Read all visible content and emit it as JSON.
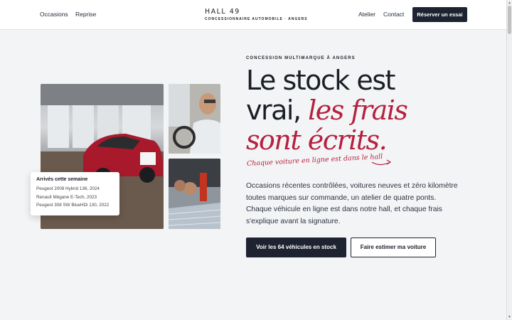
{
  "header": {
    "nav_left": [
      "Occasions",
      "Reprise"
    ],
    "brand_name": "HALL 49",
    "brand_subtitle": "CONCESSIONNAIRE AUTOMOBILE · ANGERS",
    "nav_right": [
      "Atelier",
      "Contact"
    ],
    "cta_label": "Réserver un essai"
  },
  "hero": {
    "kicker": "CONCESSION MULTIMARQUE À ANGERS",
    "headline_line1": "Le stock est",
    "headline_line2_plain": "vrai, ",
    "headline_line2_accent": "les frais",
    "headline_line3_accent": "sont écrits.",
    "script_note": "Chaque voiture en ligne est dans le hall",
    "lead": "Occasions récentes contrôlées, voitures neuves et zéro kilomètre toutes marques sur commande, un atelier de quatre ponts. Chaque véhicule en ligne est dans notre hall, et chaque frais s'explique avant la signature.",
    "primary_button": "Voir les 64 véhicules en stock",
    "secondary_button": "Faire estimer ma voiture"
  },
  "arrivals_card": {
    "title": "Arrivés cette semaine",
    "items": [
      "Peugeot 2008 Hybrid 136, 2024",
      "Renault Mégane E-Tech, 2023",
      "Peugeot 308 SW BlueHDi 130, 2022"
    ]
  },
  "colors": {
    "accent": "#b5203d",
    "dark": "#1d2330",
    "background": "#f3f4f6"
  }
}
